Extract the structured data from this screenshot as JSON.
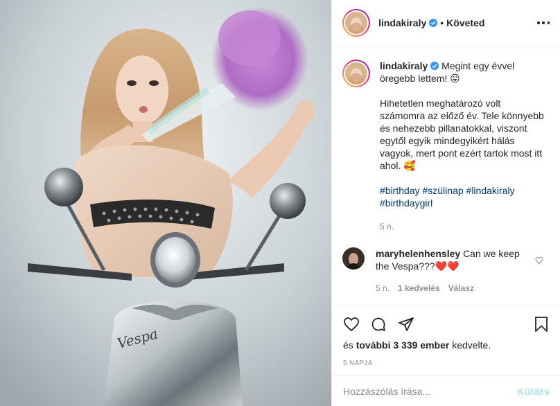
{
  "photo": {
    "brand_text": "Vespa"
  },
  "header": {
    "username": "lindakiraly",
    "separator": "•",
    "follow_status": "Követed"
  },
  "caption": {
    "username": "lindakiraly",
    "line1": "Megint egy évvel öregebb lettem! 😛",
    "paragraph": "Hihetetlen meghatározó volt számomra az előző év. Tele könnyebb és nehezebb pillanatokkal, viszont egytől egyik mindegyikért hálás vagyok, mert pont ezért tartok most itt ahol. 🥰",
    "hashtags": [
      "#birthday",
      "#szülinap",
      "#lindakiraly",
      "#birthdaygirl"
    ],
    "time": "5 n."
  },
  "comment": {
    "username": "maryhelenhensley",
    "text": "Can we keep the Vespa???❤️❤️",
    "time": "5 n.",
    "likes": "1 kedvelés",
    "reply": "Válasz"
  },
  "likes": {
    "prefix": "és",
    "count_text": "további 3 339 ember",
    "suffix": "kedvelte."
  },
  "date": "5 NAPJA",
  "add_comment": {
    "placeholder": "Hozzászólás írása...",
    "post_label": "Küldés"
  },
  "colors": {
    "link": "#00376b",
    "muted": "#8e8e8e",
    "post_disabled": "#b2dffc",
    "heart": "#ed4956"
  }
}
